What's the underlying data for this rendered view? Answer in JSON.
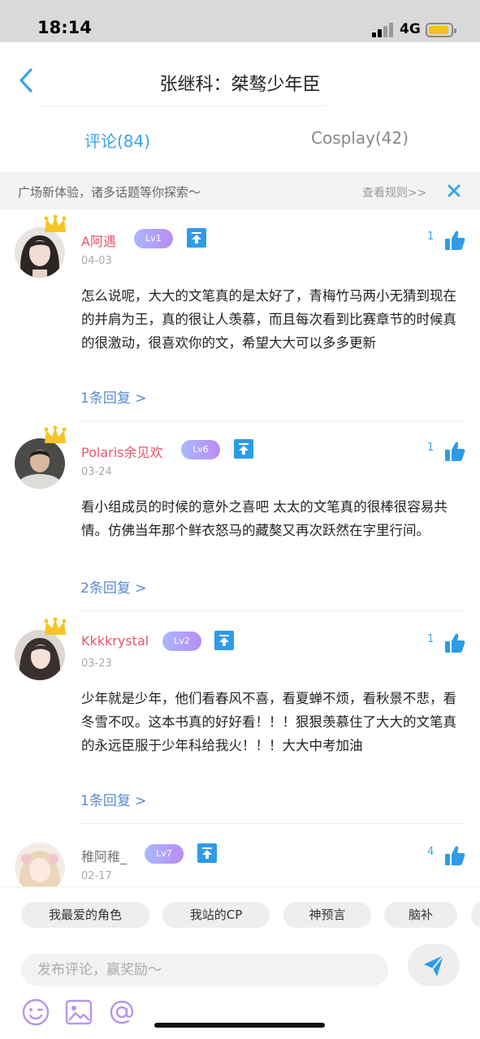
{
  "status_bar": {
    "time": "18:14",
    "network": "4G"
  },
  "header": {
    "title": "张继科：桀骜少年臣"
  },
  "tabs": [
    {
      "label": "评论(84)",
      "active": true
    },
    {
      "label": "Cosplay(42)",
      "active": false
    }
  ],
  "notice": {
    "text": "广场新体验，诸多话题等你探索～",
    "link": "查看规则>>"
  },
  "comments": [
    {
      "username": "A阿遇",
      "level": "Lv1",
      "date": "04-03",
      "likes": "1",
      "text": "怎么说呢，大大的文笔真的是太好了，青梅竹马两小无猜到现在的并肩为王，真的很让人羡慕，而且每次看到比赛章节的时候真的很激动，很喜欢你的文，希望大大可以多多更新",
      "replies": "1条回复 >"
    },
    {
      "username": "Polaris余见欢",
      "level": "Lv6",
      "date": "03-24",
      "likes": "1",
      "text": "看小组成员的时候的意外之喜吧 太太的文笔真的很棒很容易共情。仿佛当年那个鲜衣怒马的藏獒又再次跃然在字里行间。",
      "replies": "2条回复 >"
    },
    {
      "username": "Kkkkrystal",
      "level": "Lv2",
      "date": "03-23",
      "likes": "1",
      "text": "少年就是少年，他们看春风不喜，看夏蝉不烦，看秋景不悲，看冬雪不叹。这本书真的好好看！！！狠狠羡慕住了大大的文笔真的永远臣服于少年科给我火！！！大大中考加油",
      "replies": "1条回复 >"
    },
    {
      "username": "稚阿稚_",
      "level": "Lv7",
      "date": "02-17",
      "likes": "4"
    }
  ],
  "topic_chips": [
    "我最爱的角色",
    "我站的CP",
    "神预言",
    "脑补"
  ],
  "comment_input": {
    "placeholder": "发布评论，赢奖励～"
  },
  "colors": {
    "accent": "#3aa3e6",
    "username": "#e8566a",
    "reply_link": "#5b8bd1"
  }
}
